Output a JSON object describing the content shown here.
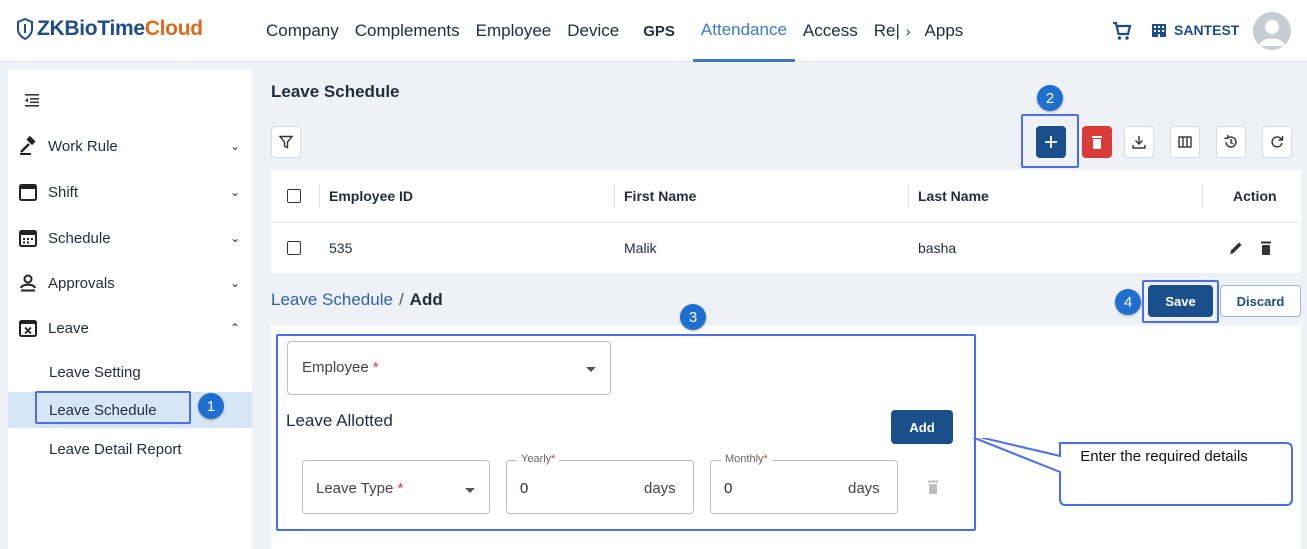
{
  "app": {
    "logo_prefix": "ZKBioTime",
    "logo_suffix": "Cloud",
    "tenant": "SANTEST"
  },
  "nav": {
    "items": [
      "Company",
      "Complements",
      "Employee",
      "Device",
      "GPS",
      "Attendance",
      "Access",
      "Re|"
    ],
    "more": "›",
    "apps": "Apps",
    "active": "Attendance"
  },
  "sidebar": {
    "menu": [
      {
        "label": "Work Rule",
        "icon": "gavel-icon",
        "arrow": "⌄"
      },
      {
        "label": "Shift",
        "icon": "calendar-icon",
        "arrow": "⌄"
      },
      {
        "label": "Schedule",
        "icon": "calendar-grid-icon",
        "arrow": "⌄"
      },
      {
        "label": "Approvals",
        "icon": "user-check-icon",
        "arrow": "⌄"
      },
      {
        "label": "Leave",
        "icon": "calendar-x-icon",
        "arrow": "⌃"
      }
    ],
    "sub": [
      "Leave Setting",
      "Leave Schedule",
      "Leave Detail Report"
    ],
    "active_sub": "Leave Schedule"
  },
  "page": {
    "title": "Leave Schedule"
  },
  "table": {
    "columns": [
      "Employee ID",
      "First Name",
      "Last Name",
      "Action"
    ],
    "rows": [
      {
        "id": "535",
        "first": "Malik",
        "last": "basha"
      }
    ]
  },
  "form": {
    "breadcrumb_parent": "Leave Schedule",
    "breadcrumb_sep": "/",
    "breadcrumb_current": "Add",
    "save_label": "Save",
    "discard_label": "Discard",
    "employee_label": "Employee",
    "required_mark": "*",
    "section_title": "Leave Allotted",
    "add_label": "Add",
    "leave_type_label": "Leave Type",
    "yearly_label": "Yearly",
    "yearly_value": "0",
    "monthly_label": "Monthly",
    "monthly_value": "0",
    "unit": "days"
  },
  "annotations": {
    "steps": [
      "1",
      "2",
      "3",
      "4"
    ],
    "callout": "Enter the required details"
  },
  "colors": {
    "primary": "#1a4f8b",
    "danger": "#d93a3a",
    "accent": "#3b7bc4",
    "highlight": "#4a6ef0",
    "logo_orange": "#e06a1b"
  }
}
